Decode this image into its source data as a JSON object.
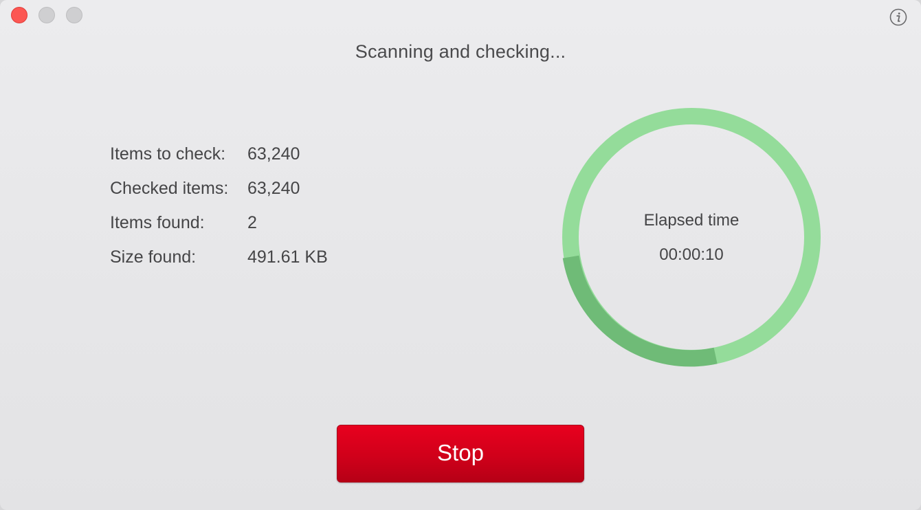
{
  "window": {
    "title": "Scanning and checking..."
  },
  "controls": {
    "close_color": "#fc5753",
    "inactive_color": "#cfcfd1",
    "info_icon": "info-icon"
  },
  "stats": [
    {
      "label": "Items to check:",
      "value": "63,240"
    },
    {
      "label": "Checked items:",
      "value": "63,240"
    },
    {
      "label": "Items found:",
      "value": "2"
    },
    {
      "label": "Size found:",
      "value": "491.61 KB"
    }
  ],
  "progress": {
    "label": "Elapsed time",
    "time": "00:00:10",
    "track_color": "#94dc9a",
    "accent_color": "#6fbb77"
  },
  "actions": {
    "stop_label": "Stop",
    "stop_color": "#d4001b"
  }
}
